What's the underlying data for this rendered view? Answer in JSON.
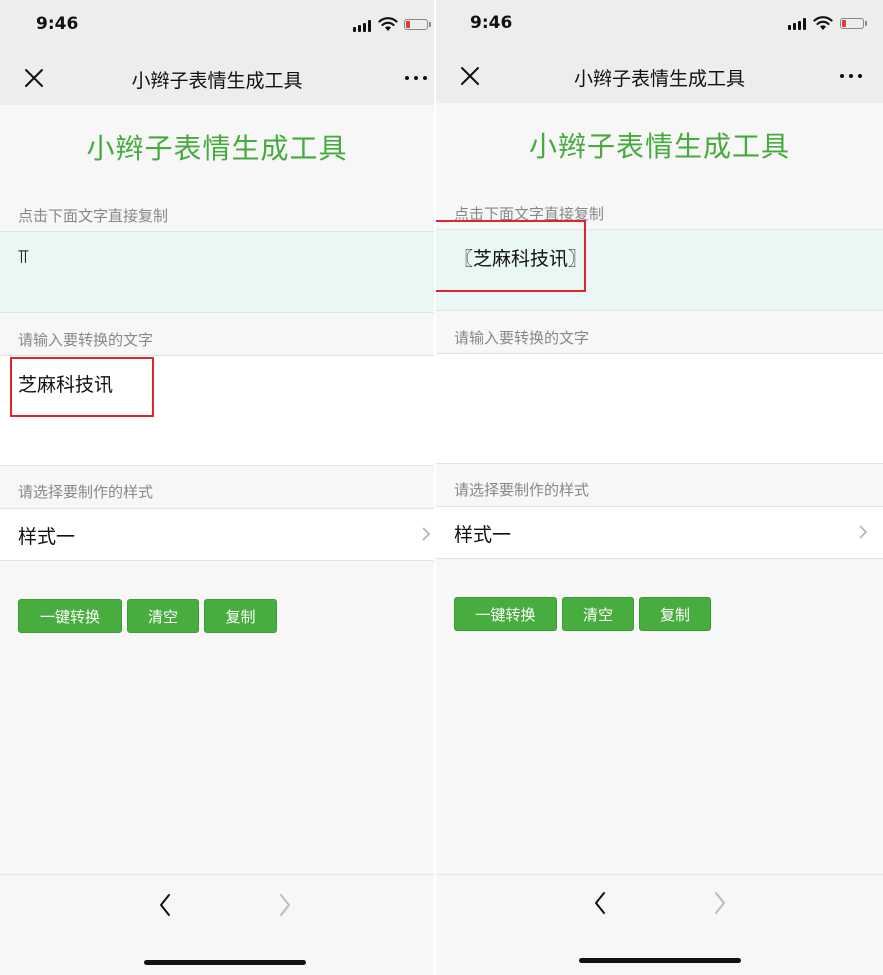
{
  "status": {
    "time": "9:46"
  },
  "nav": {
    "title": "小辫子表情生成工具"
  },
  "app": {
    "title": "小辫子表情生成工具"
  },
  "labels": {
    "copy_hint": "点击下面文字直接复制",
    "input_hint": "请输入要转换的文字",
    "style_hint": "请选择要制作的样式"
  },
  "left": {
    "result_text": "⫪",
    "input_text": "芝麻科技讯",
    "style_value": "样式一"
  },
  "right": {
    "result_text": "〖芝麻科技讯〗",
    "input_text": "",
    "style_value": "样式一"
  },
  "buttons": {
    "convert": "一键转换",
    "clear": "清空",
    "copy": "复制"
  },
  "colors": {
    "accent": "#45ab3c",
    "button": "#47ad3e",
    "highlight": "#e0262b",
    "result_bg": "#e9f7f5"
  }
}
